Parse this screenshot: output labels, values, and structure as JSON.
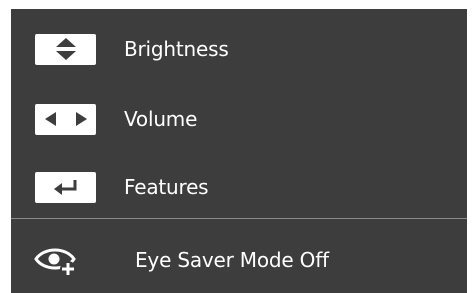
{
  "menu": {
    "items": [
      {
        "label": "Brightness",
        "icon": "up-down-arrows-icon"
      },
      {
        "label": "Volume",
        "icon": "left-right-arrows-icon"
      },
      {
        "label": "Features",
        "icon": "enter-return-icon"
      }
    ],
    "eye_saver": {
      "label": "Eye Saver Mode Off",
      "icon": "eye-plus-icon"
    }
  },
  "colors": {
    "panel_background": "#3d3d3d",
    "text": "#ffffff",
    "key_background": "#ffffff",
    "key_glyph": "#3d3d3d",
    "divider": "#8a8a8a"
  }
}
